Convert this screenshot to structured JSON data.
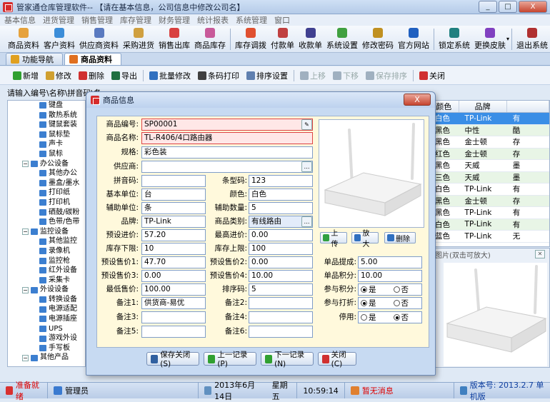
{
  "window": {
    "title": "管家通仓库管理软件-- 【请在基本信息，公司信息中修改公司名】",
    "controls": [
      "_",
      "□",
      "X"
    ]
  },
  "menu": [
    "基本信息",
    "进货管理",
    "销售管理",
    "库存管理",
    "财务管理",
    "统计报表",
    "系统管理",
    "窗口"
  ],
  "toolbar": [
    {
      "label": "商品资料",
      "color": "#e6a23c"
    },
    {
      "label": "客户资料",
      "color": "#3c8dd8"
    },
    {
      "label": "供应商资料",
      "color": "#5a7ac0"
    },
    {
      "label": "采购进货",
      "color": "#d0a040"
    },
    {
      "label": "销售出库",
      "color": "#d84040"
    },
    {
      "label": "商品库存",
      "color": "#c85a9a"
    },
    {
      "label": "库存调拨",
      "color": "#e05030"
    },
    {
      "label": "付款单",
      "color": "#c04040"
    },
    {
      "label": "收款单",
      "color": "#404090"
    },
    {
      "label": "系统设置",
      "color": "#40a040"
    },
    {
      "label": "修改密码",
      "color": "#c09020"
    },
    {
      "label": "官方网站",
      "color": "#2060c0"
    },
    {
      "label": "锁定系统",
      "color": "#208080"
    },
    {
      "label": "更换皮肤",
      "color": "#8040c0"
    },
    {
      "label": "退出系统",
      "color": "#b03030"
    }
  ],
  "tabs": [
    {
      "label": "功能导航",
      "color": "#e0a020"
    },
    {
      "label": "商品资料",
      "color": "#e07020"
    }
  ],
  "actions": [
    {
      "label": "新增",
      "color": "#30a030"
    },
    {
      "label": "修改",
      "color": "#d0a030"
    },
    {
      "label": "删除",
      "color": "#d03030"
    },
    {
      "label": "导出",
      "color": "#207040"
    },
    {
      "label": "批量修改",
      "color": "#3070c0"
    },
    {
      "label": "条码打印",
      "color": "#404040"
    },
    {
      "label": "排序设置",
      "color": "#6080b0"
    },
    {
      "label": "上移",
      "color": "#a0b0c0",
      "disabled": true
    },
    {
      "label": "下移",
      "color": "#a0b0c0",
      "disabled": true
    },
    {
      "label": "保存排序",
      "color": "#a0b0c0",
      "disabled": true
    },
    {
      "label": "关闭",
      "color": "#d03030"
    }
  ],
  "search_label": "请输入编号\\名称\\拼音码\\条",
  "tree": [
    {
      "label": "键盘",
      "level": 2
    },
    {
      "label": "散热系统",
      "level": 2
    },
    {
      "label": "键鼠套装",
      "level": 2
    },
    {
      "label": "鼠标垫",
      "level": 2
    },
    {
      "label": "声卡",
      "level": 2
    },
    {
      "label": "鼠标",
      "level": 2
    },
    {
      "label": "办公设备",
      "level": 1
    },
    {
      "label": "其他办公",
      "level": 2
    },
    {
      "label": "墨盒/墨水",
      "level": 2
    },
    {
      "label": "打印纸",
      "level": 2
    },
    {
      "label": "打印机",
      "level": 2
    },
    {
      "label": "硒鼓/碳粉",
      "level": 2
    },
    {
      "label": "色带/色带",
      "level": 2
    },
    {
      "label": "监控设备",
      "level": 1
    },
    {
      "label": "其他监控",
      "level": 2
    },
    {
      "label": "录像机",
      "level": 2
    },
    {
      "label": "监控枪",
      "level": 2
    },
    {
      "label": "红外设备",
      "level": 2
    },
    {
      "label": "采集卡",
      "level": 2
    },
    {
      "label": "外设设备",
      "level": 1
    },
    {
      "label": "转换设备",
      "level": 2
    },
    {
      "label": "电源适配",
      "level": 2
    },
    {
      "label": "电源插座",
      "level": 2
    },
    {
      "label": "UPS",
      "level": 2
    },
    {
      "label": "游戏外设",
      "level": 2
    },
    {
      "label": "手写板",
      "level": 2
    },
    {
      "label": "其他产品",
      "level": 1
    }
  ],
  "grid": {
    "headers": [
      "颜色",
      "品牌",
      ""
    ],
    "rows": [
      [
        "白色",
        "TP-Link",
        "有"
      ],
      [
        "黑色",
        "中性",
        "酷"
      ],
      [
        "黑色",
        "金士顿",
        "存"
      ],
      [
        "红色",
        "金士顿",
        "存"
      ],
      [
        "黑色",
        "天威",
        "墨"
      ],
      [
        "三色",
        "天威",
        "墨"
      ],
      [
        "白色",
        "TP-Link",
        "有"
      ],
      [
        "黑色",
        "金士顿",
        "存"
      ],
      [
        "黑色",
        "TP-Link",
        "有"
      ],
      [
        "白色",
        "TP-Link",
        "有"
      ],
      [
        "蓝色",
        "TP-Link",
        "无"
      ]
    ]
  },
  "preview_panel_title": "图片(双击可放大)",
  "dialog": {
    "title": "商品信息",
    "close_label": "X",
    "fields": {
      "code": {
        "label": "商品编号:",
        "value": "SP00001"
      },
      "name": {
        "label": "商品名称:",
        "value": "TL-R406/4口路由器"
      },
      "spec": {
        "label": "规格:",
        "value": "彩色装"
      },
      "supplier": {
        "label": "供应商:",
        "value": ""
      },
      "pinyin": {
        "label": "拼音码:",
        "value": ""
      },
      "barcode": {
        "label": "条型码:",
        "value": "123"
      },
      "unit": {
        "label": "基本单位:",
        "value": "台"
      },
      "color": {
        "label": "颜色:",
        "value": "白色"
      },
      "aux_unit": {
        "label": "辅助单位:",
        "value": "条"
      },
      "aux_qty": {
        "label": "辅助数量:",
        "value": "5"
      },
      "brand": {
        "label": "品牌:",
        "value": "TP-Link"
      },
      "category": {
        "label": "商品类别:",
        "value": "有线路由"
      },
      "pre_purchase": {
        "label": "预设进价:",
        "value": "57.20"
      },
      "max_purchase": {
        "label": "最高进价:",
        "value": "0.00"
      },
      "stock_min": {
        "label": "库存下限:",
        "value": "10"
      },
      "stock_max": {
        "label": "库存上限:",
        "value": "100"
      },
      "price1": {
        "label": "预设售价1:",
        "value": "47.70"
      },
      "price2": {
        "label": "预设售价2:",
        "value": "0.00"
      },
      "price3": {
        "label": "预设售价3:",
        "value": "0.00"
      },
      "price4": {
        "label": "预设售价4:",
        "value": "10.00"
      },
      "min_price": {
        "label": "最低售价:",
        "value": "100.00"
      },
      "sort_code": {
        "label": "排序码:",
        "value": "5"
      },
      "note1": {
        "label": "备注1:",
        "value": "供货商-易优"
      },
      "note2": {
        "label": "备注2:",
        "value": ""
      },
      "note3": {
        "label": "备注3:",
        "value": ""
      },
      "note4": {
        "label": "备注4:",
        "value": ""
      },
      "note5": {
        "label": "备注5:",
        "value": ""
      },
      "note6": {
        "label": "备注6:",
        "value": ""
      },
      "commission": {
        "label": "单品提成:",
        "value": "5.00"
      },
      "points": {
        "label": "单品积分:",
        "value": "10.00"
      }
    },
    "radios": {
      "join_points": {
        "label": "参与积分:",
        "yes": "是",
        "no": "否",
        "selected": "yes"
      },
      "join_discount": {
        "label": "参与打折:",
        "yes": "是",
        "no": "否",
        "selected": "yes"
      },
      "disabled": {
        "label": "停用:",
        "yes": "是",
        "no": "否",
        "selected": "no"
      }
    },
    "image_buttons": [
      {
        "label": "上传",
        "color": "#30a040"
      },
      {
        "label": "放大",
        "color": "#3070c0"
      },
      {
        "label": "删除",
        "color": "#3070c0"
      }
    ],
    "buttons": [
      {
        "label": "保存关闭(S)",
        "color": "#3060a0"
      },
      {
        "label": "上一记录(P)",
        "color": "#30a030"
      },
      {
        "label": "下一记录(N)",
        "color": "#30a030"
      },
      {
        "label": "关闭(C)",
        "color": "#d03030"
      }
    ]
  },
  "statusbar": {
    "ready": "准备就绪",
    "user": "管理员",
    "date": "2013年6月14日",
    "weekday": "星期五",
    "time": "10:59:14",
    "message": "暂无消息",
    "version": "版本号: 2013.2.7  单机版"
  }
}
